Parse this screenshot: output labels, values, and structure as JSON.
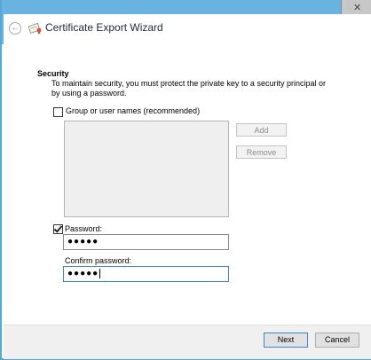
{
  "window": {
    "close_glyph": "✕"
  },
  "header": {
    "back_icon": "back-arrow-icon",
    "wizard_icon": "certificate-icon",
    "title": "Certificate Export Wizard"
  },
  "security": {
    "heading": "Security",
    "description": "To maintain security, you must protect the private key to a security principal or by using a password."
  },
  "group_option": {
    "label": "Group or user names (recommended)",
    "checked": false
  },
  "list_buttons": {
    "add": "Add",
    "remove": "Remove"
  },
  "password": {
    "checkbox_label": "Password:",
    "checked": true,
    "value": "●●●●●"
  },
  "confirm_password": {
    "label": "Confirm password:",
    "value": "●●●●●"
  },
  "footer": {
    "next": "Next",
    "cancel": "Cancel"
  }
}
